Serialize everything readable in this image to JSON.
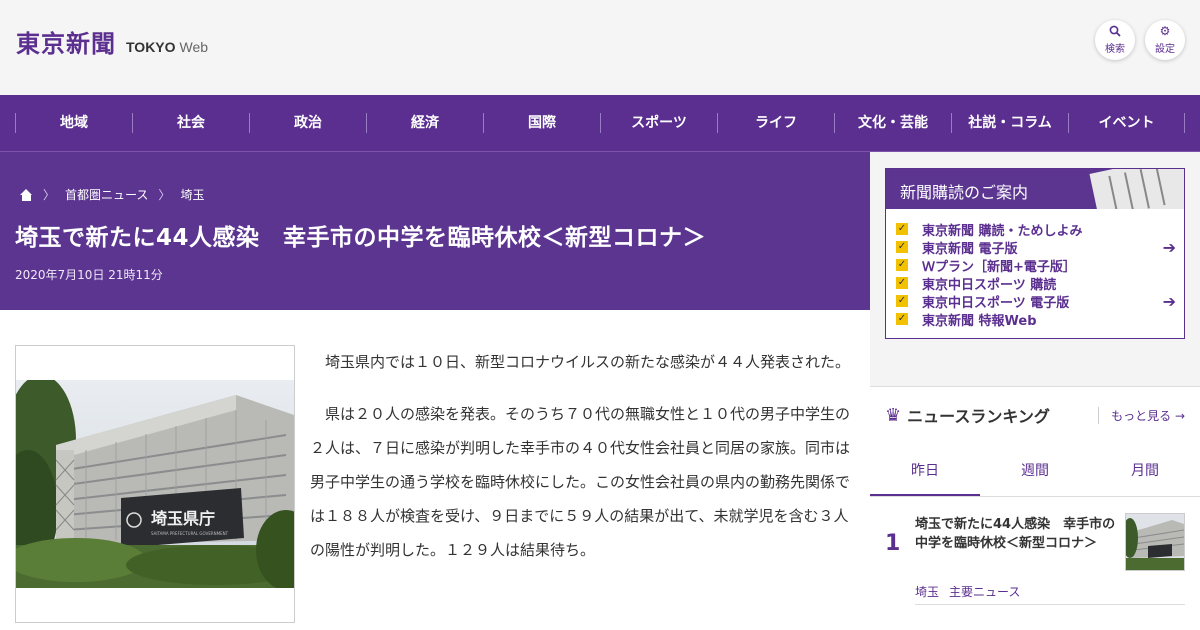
{
  "header": {
    "logo_jp": "東京新聞",
    "logo_tokyo": "TOKYO",
    "logo_web": "Web",
    "search_label": "検索",
    "settings_label": "設定"
  },
  "nav": [
    "地域",
    "社会",
    "政治",
    "経済",
    "国際",
    "スポーツ",
    "ライフ",
    "文化・芸能",
    "社説・コラム",
    "イベント"
  ],
  "breadcrumb": [
    "首都圏ニュース",
    "埼玉"
  ],
  "article": {
    "title": "埼玉で新たに44人感染　幸手市の中学を臨時休校＜新型コロナ＞",
    "date": "2020年7月10日 21時11分",
    "paragraphs": [
      "埼玉県内では１０日、新型コロナウイルスの新たな感染が４４人発表された。",
      "県は２０人の感染を発表。そのうち７０代の無職女性と１０代の男子中学生の２人は、７日に感染が判明した幸手市の４０代女性会社員と同居の家族。同市は男子中学生の通う学校を臨時休校にした。この女性会社員の県内の勤務先関係では１８８人が検査を受け、９日までに５９人の結果が出て、未就学児を含む３人の陽性が判明した。１２９人は結果待ち。"
    ],
    "photo_sign": "埼玉県庁",
    "photo_sign_sub": "SAITAMA PREFECTURAL GOVERNMENT"
  },
  "subscription": {
    "title": "新聞購読のご案内",
    "items": [
      {
        "label": "東京新聞 購読・ためしよみ",
        "login": false
      },
      {
        "label": "東京新聞 電子版",
        "login": true
      },
      {
        "label": "Ｗプラン［新聞+電子版］",
        "login": false
      },
      {
        "label": "東京中日スポーツ 購読",
        "login": false
      },
      {
        "label": "東京中日スポーツ 電子版",
        "login": true
      },
      {
        "label": "東京新聞 特報Web",
        "login": false
      }
    ]
  },
  "ranking": {
    "title": "ニュースランキング",
    "more": "もっと見る",
    "tabs": [
      "昨日",
      "週間",
      "月間"
    ],
    "active_tab": 0,
    "items": [
      {
        "rank": "1",
        "title": "埼玉で新たに44人感染　幸手市の中学を臨時休校＜新型コロナ＞",
        "tags": [
          "埼玉",
          "主要ニュース"
        ]
      }
    ]
  },
  "colors": {
    "brand": "#5b2f8f",
    "check": "#f2c200"
  }
}
